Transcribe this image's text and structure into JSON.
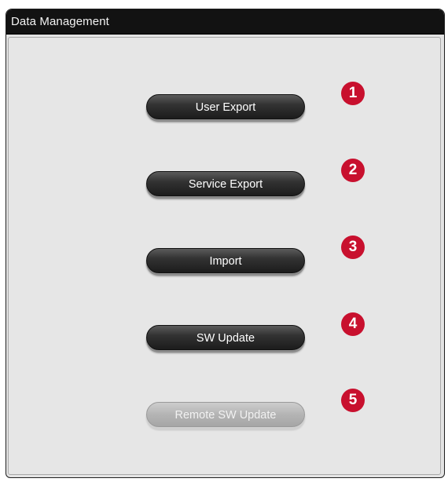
{
  "dialog": {
    "title": "Data Management"
  },
  "buttons": [
    {
      "label": "User Export",
      "enabled": true
    },
    {
      "label": "Service Export",
      "enabled": true
    },
    {
      "label": "Import",
      "enabled": true
    },
    {
      "label": "SW Update",
      "enabled": true
    },
    {
      "label": "Remote SW Update",
      "enabled": false
    }
  ],
  "callouts": [
    "1",
    "2",
    "3",
    "4",
    "5"
  ],
  "colors": {
    "callout": "#c8102e",
    "titlebar": "#121212",
    "panel_bg": "#e6e6e6"
  }
}
